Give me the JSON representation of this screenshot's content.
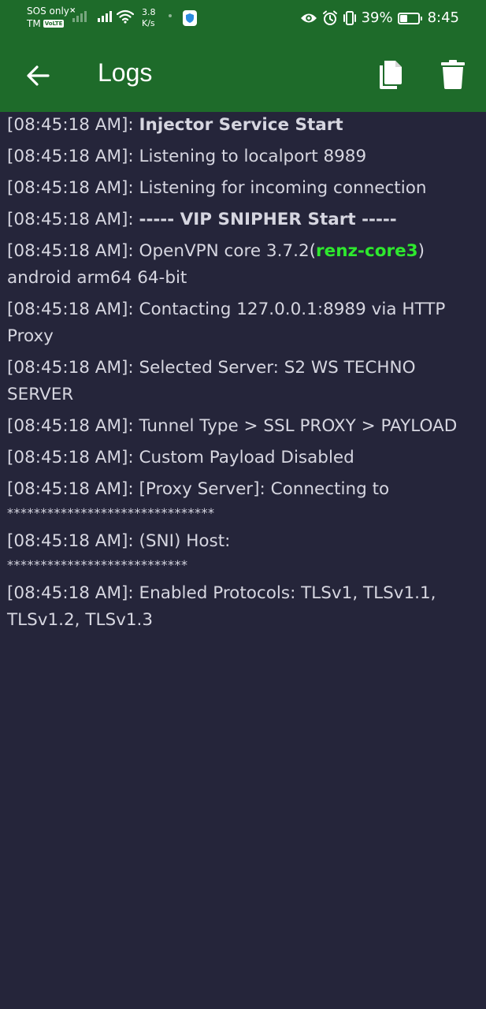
{
  "status_bar": {
    "carrier_line1": "SOS only",
    "carrier_line2": "TM",
    "volte": "VoLTE",
    "speed_value": "3.8",
    "speed_unit": "K/s",
    "battery_percent": "39%",
    "battery_level": 0.39,
    "time": "8:45"
  },
  "app_bar": {
    "title": "Logs"
  },
  "logs": [
    {
      "ts": "[08:45:18 AM]: ",
      "msg": "Injector Service Start",
      "style": "bold"
    },
    {
      "ts": "[08:45:18 AM]: ",
      "msg": "Listening to localport 8989"
    },
    {
      "ts": "[08:45:18 AM]: ",
      "msg": "Listening for incoming connection"
    },
    {
      "ts": "[08:45:18 AM]: ",
      "msg": "----- VIP SNIPHER Start -----",
      "style": "bold"
    },
    {
      "ts": "[08:45:18 AM]: ",
      "msg_pre": "OpenVPN core 3.7.2(",
      "msg_highlight": "renz-core3",
      "msg_post": ") android arm64 64-bit"
    },
    {
      "ts": "[08:45:18 AM]: ",
      "msg": "Contacting 127.0.0.1:8989 via HTTP Proxy"
    },
    {
      "ts": "[08:45:18 AM]: ",
      "msg": "Selected Server: S2 WS TECHNO SERVER"
    },
    {
      "ts": "[08:45:18 AM]: ",
      "msg": "Tunnel Type > SSL PROXY > PAYLOAD"
    },
    {
      "ts": "[08:45:18 AM]: ",
      "msg": "Custom Payload Disabled"
    },
    {
      "ts": "[08:45:18 AM]: ",
      "msg": "[Proxy Server]: Connecting to",
      "masked": "*******************************"
    },
    {
      "ts": "[08:45:18 AM]: ",
      "msg": "(SNI) Host:",
      "masked": "***************************"
    },
    {
      "ts": "[08:45:18 AM]: ",
      "msg": "Enabled Protocols: TLSv1, TLSv1.1, TLSv1.2, TLSv1.3"
    }
  ],
  "colors": {
    "app_bar": "#1e6b2a",
    "background": "#25253a",
    "log_text": "#d6d6e0",
    "highlight": "#2ee82e"
  }
}
